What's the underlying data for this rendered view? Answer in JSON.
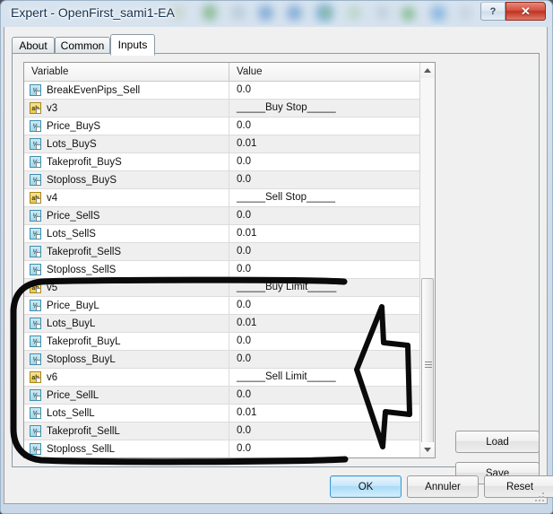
{
  "window": {
    "title": "Expert - OpenFirst_sami1-EA",
    "help_button": "?",
    "close_button": "✕"
  },
  "tabs": [
    {
      "label": "About",
      "active": false
    },
    {
      "label": "Common",
      "active": false
    },
    {
      "label": "Inputs",
      "active": true
    }
  ],
  "grid": {
    "columns": [
      "Variable",
      "Value"
    ],
    "rows": [
      {
        "icon": "number-variable-icon",
        "type": "num",
        "name": "BreakEvenPips_Sell",
        "value": "0.0"
      },
      {
        "icon": "string-variable-icon",
        "type": "str",
        "name": "v3",
        "value": "_____Buy Stop_____"
      },
      {
        "icon": "number-variable-icon",
        "type": "num",
        "name": "Price_BuyS",
        "value": "0.0"
      },
      {
        "icon": "number-variable-icon",
        "type": "num",
        "name": "Lots_BuyS",
        "value": "0.01"
      },
      {
        "icon": "number-variable-icon",
        "type": "num",
        "name": "Takeprofit_BuyS",
        "value": "0.0"
      },
      {
        "icon": "number-variable-icon",
        "type": "num",
        "name": "Stoploss_BuyS",
        "value": "0.0"
      },
      {
        "icon": "string-variable-icon",
        "type": "str",
        "name": "v4",
        "value": "_____Sell Stop_____"
      },
      {
        "icon": "number-variable-icon",
        "type": "num",
        "name": "Price_SellS",
        "value": "0.0"
      },
      {
        "icon": "number-variable-icon",
        "type": "num",
        "name": "Lots_SellS",
        "value": "0.01"
      },
      {
        "icon": "number-variable-icon",
        "type": "num",
        "name": "Takeprofit_SellS",
        "value": "0.0"
      },
      {
        "icon": "number-variable-icon",
        "type": "num",
        "name": "Stoploss_SellS",
        "value": "0.0"
      },
      {
        "icon": "string-variable-icon",
        "type": "str",
        "name": "v5",
        "value": "_____Buy Limit_____"
      },
      {
        "icon": "number-variable-icon",
        "type": "num",
        "name": "Price_BuyL",
        "value": "0.0"
      },
      {
        "icon": "number-variable-icon",
        "type": "num",
        "name": "Lots_BuyL",
        "value": "0.01"
      },
      {
        "icon": "number-variable-icon",
        "type": "num",
        "name": "Takeprofit_BuyL",
        "value": "0.0"
      },
      {
        "icon": "number-variable-icon",
        "type": "num",
        "name": "Stoploss_BuyL",
        "value": "0.0"
      },
      {
        "icon": "string-variable-icon",
        "type": "str",
        "name": "v6",
        "value": "_____Sell Limit_____"
      },
      {
        "icon": "number-variable-icon",
        "type": "num",
        "name": "Price_SellL",
        "value": "0.0"
      },
      {
        "icon": "number-variable-icon",
        "type": "num",
        "name": "Lots_SellL",
        "value": "0.01"
      },
      {
        "icon": "number-variable-icon",
        "type": "num",
        "name": "Takeprofit_SellL",
        "value": "0.0"
      },
      {
        "icon": "number-variable-icon",
        "type": "num",
        "name": "Stoploss_SellL",
        "value": "0.0"
      }
    ]
  },
  "side_buttons": {
    "load": "Load",
    "save": "Save"
  },
  "bottom_buttons": {
    "ok": "OK",
    "cancel": "Annuler",
    "reset": "Reset"
  },
  "annotations": {
    "highlight_box": "rounded-rectangle-around-buy-limit-and-sell-limit-rows",
    "arrow": "left-pointing-arrow-toward-highlight-box"
  },
  "colors": {
    "accent": "#3c9ad4",
    "close_button": "#bf3222",
    "number_icon": "#9fd7ea",
    "string_icon": "#e8c948",
    "annotation": "#000000"
  }
}
